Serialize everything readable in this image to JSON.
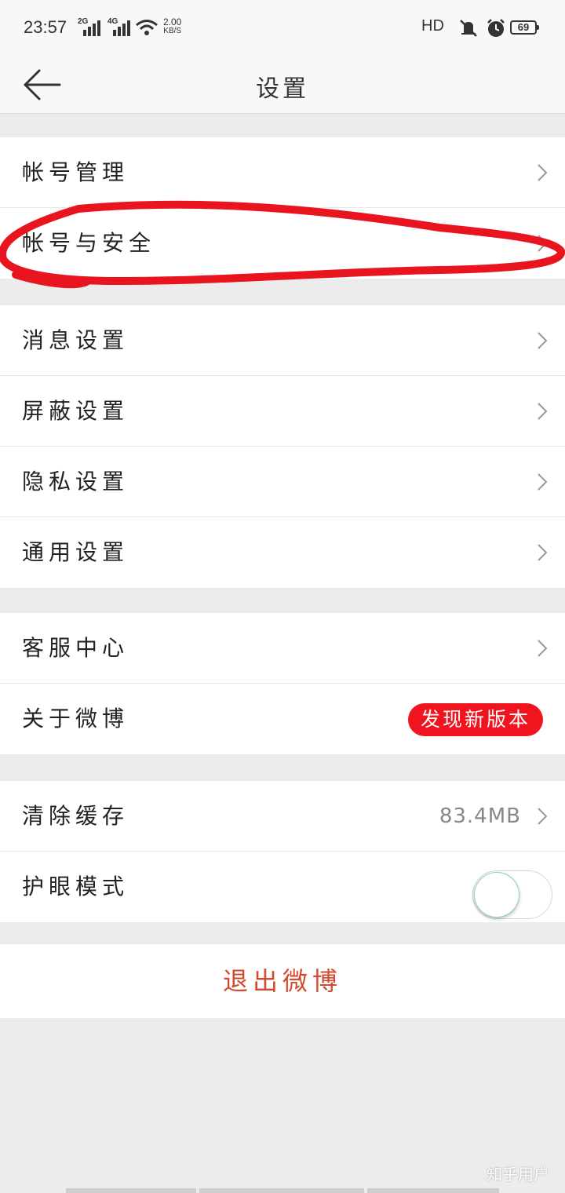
{
  "status_bar": {
    "time": "23:57",
    "net1": "2G",
    "net2": "4G",
    "speed_value": "2.00",
    "speed_unit": "KB/S",
    "hd": "HD",
    "battery": "69"
  },
  "header": {
    "title": "设置"
  },
  "groups": {
    "account": [
      {
        "label": "帐号管理"
      },
      {
        "label": "帐号与安全"
      }
    ],
    "settings": [
      {
        "label": "消息设置"
      },
      {
        "label": "屏蔽设置"
      },
      {
        "label": "隐私设置"
      },
      {
        "label": "通用设置"
      }
    ],
    "service": [
      {
        "label": "客服中心"
      },
      {
        "label": "关于微博",
        "badge": "发现新版本"
      }
    ],
    "storage": [
      {
        "label": "清除缓存",
        "value": "83.4MB"
      },
      {
        "label": "护眼模式",
        "toggle_on": false
      }
    ]
  },
  "logout_label": "退出微博",
  "watermark": "知乎用户",
  "colors": {
    "accent_red": "#f0141e",
    "logout_text": "#d24a2c",
    "annotation": "#e8141e"
  }
}
